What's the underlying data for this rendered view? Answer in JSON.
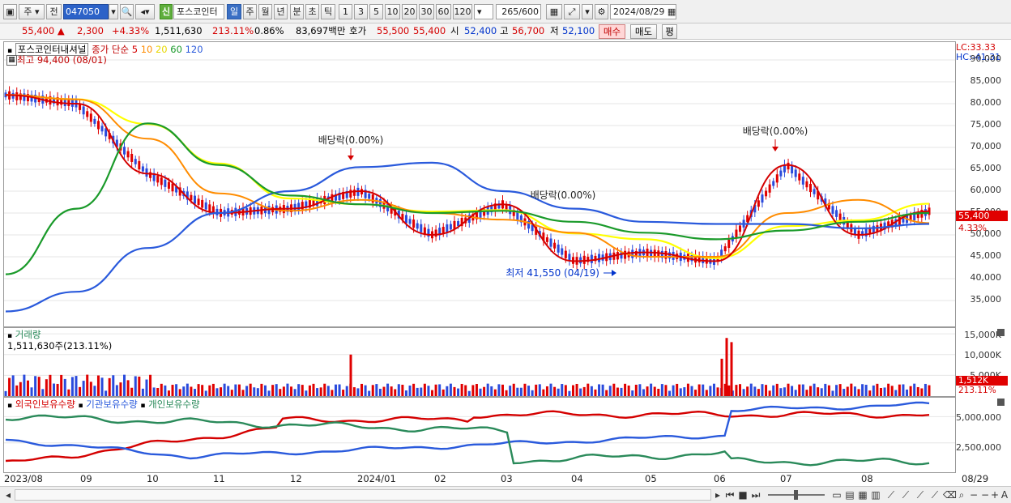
{
  "toolbar": {
    "period_select": "주",
    "prev": "전",
    "code": "047050",
    "badge": "신",
    "name": "포스코인터",
    "periods": [
      "일",
      "주",
      "월",
      "년",
      "분",
      "초",
      "틱"
    ],
    "active_period": "일",
    "ranges": [
      "1",
      "3",
      "5",
      "10",
      "20",
      "30",
      "60",
      "120"
    ],
    "count": "265",
    "total": "/600",
    "date": "2024/08/29"
  },
  "quote": {
    "price": "55,400",
    "change": "2,300",
    "change_pct": "+4.33%",
    "volume": "1,511,630",
    "vol_ratio": "213.11%",
    "turnover": "0.86%",
    "amount": "83,697백만",
    "ask_label": "호가",
    "ask": "55,500",
    "bid": "55,400",
    "open_label": "시",
    "open": "52,400",
    "high_label": "고",
    "high": "56,700",
    "low_label": "저",
    "low": "52,100",
    "buy": "매수",
    "sell": "매도",
    "eval": "평"
  },
  "price_panel": {
    "title": "포스코인터내셔널",
    "ma_label": "종가 단순",
    "ma_periods": [
      "5",
      "10",
      "20",
      "60",
      "120"
    ],
    "ma_colors": [
      "#d40000",
      "#ff8c00",
      "#ffff00",
      "#1a9a2a",
      "#2a5adc"
    ],
    "max_label": "최고 94,400 (08/01)",
    "min_label": "최저 41,550 (04/19)",
    "dividend_label": "배당락(0.00%)",
    "lc": "LC:33.33",
    "hc": "HC:-41.31",
    "last_price": "55,400",
    "last_pct": "4.33%",
    "ticks": [
      "90,000",
      "85,000",
      "80,000",
      "75,000",
      "70,000",
      "65,000",
      "60,000",
      "55,000",
      "50,000",
      "45,000",
      "40,000",
      "35,000"
    ]
  },
  "volume_panel": {
    "title": "거래량",
    "info": "1,511,630주(213.11%)",
    "ticks": [
      "15,000K",
      "10,000K",
      "5,000K"
    ],
    "last": "1,512K",
    "last_pct": "213.11%"
  },
  "holding_panel": {
    "legend": [
      "외국인보유수량",
      "기관보유수량",
      "개인보유수량"
    ],
    "colors": [
      "#d40000",
      "#2a5adc",
      "#2a8a5a"
    ],
    "ticks": [
      "5,000,000",
      "2,500,000"
    ]
  },
  "x_axis": {
    "labels": [
      "2023/08",
      "09",
      "10",
      "11",
      "12",
      "2024/01",
      "02",
      "03",
      "04",
      "05",
      "06",
      "07",
      "08"
    ],
    "end": "08/29"
  },
  "chart_data": {
    "type": "line",
    "title": "포스코인터내셔널",
    "x": [
      "2023/08",
      "09",
      "10",
      "11",
      "12",
      "2024/01",
      "02",
      "03",
      "04",
      "05",
      "06",
      "07",
      "08",
      "08/29"
    ],
    "series": [
      {
        "name": "종가",
        "values": [
          82000,
          80000,
          64000,
          55000,
          56000,
          60000,
          50000,
          57000,
          44000,
          46000,
          44000,
          66000,
          50000,
          55400
        ]
      },
      {
        "name": "120",
        "values": [
          32500,
          37000,
          47000,
          55000,
          60000,
          65500,
          66500,
          60000,
          56000,
          53000,
          52500,
          52500,
          51500,
          52500
        ]
      },
      {
        "name": "60",
        "values": [
          41000,
          56000,
          75500,
          66000,
          59000,
          57000,
          55000,
          55500,
          53000,
          50500,
          49000,
          51000,
          53000,
          55000
        ]
      }
    ],
    "ylim": [
      30000,
      95000
    ]
  },
  "volume_data": {
    "type": "bar",
    "spikes": [
      {
        "x": "2024/01",
        "value": 10000
      },
      {
        "x": "06",
        "value": 9000
      },
      {
        "x": "06",
        "value": 14000
      },
      {
        "x": "06",
        "value": 13000
      }
    ],
    "last": 1512
  }
}
